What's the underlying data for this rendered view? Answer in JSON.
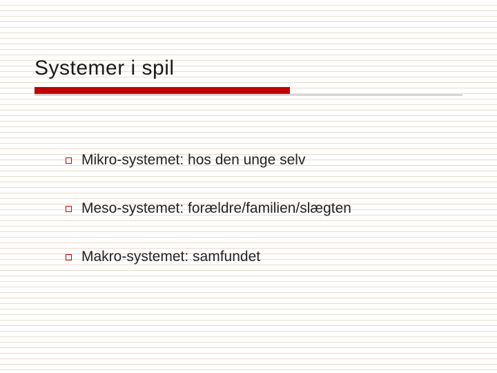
{
  "title": "Systemer i spil",
  "items": [
    "Mikro-systemet: hos den unge selv",
    "Meso-systemet: forældre/familien/slægten",
    "Makro-systemet: samfundet"
  ],
  "colors": {
    "accent": "#c00000",
    "rule": "#e9d9c9"
  }
}
